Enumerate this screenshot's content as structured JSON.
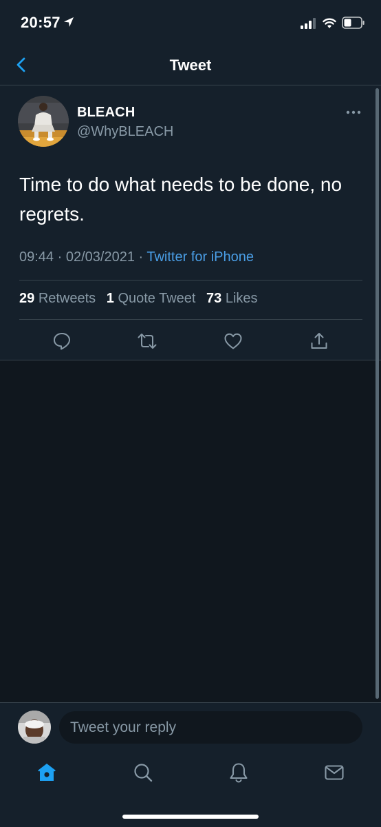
{
  "status_bar": {
    "time": "20:57"
  },
  "nav": {
    "title": "Tweet"
  },
  "tweet": {
    "author_name": "BLEACH",
    "author_handle": "@WhyBLEACH",
    "text": "Time to do what needs to be done, no regrets.",
    "time": "09:44",
    "date": "02/03/2021",
    "source": "Twitter for iPhone",
    "stats": {
      "retweets_count": "29",
      "retweets_label": "Retweets",
      "quotes_count": "1",
      "quotes_label": "Quote Tweet",
      "likes_count": "73",
      "likes_label": "Likes"
    },
    "actions": [
      "reply-icon",
      "retweet-icon",
      "like-icon",
      "share-icon"
    ]
  },
  "reply": {
    "placeholder": "Tweet your reply"
  },
  "tab_bar": {
    "items": [
      "home-icon",
      "search-icon",
      "notifications-icon",
      "messages-icon"
    ]
  },
  "colors": {
    "background": "#15202b",
    "background_dark": "#10171e",
    "accent": "#1da1f2",
    "link": "#4a9ee6",
    "secondary_text": "#8899a6",
    "divider": "#38444d"
  }
}
